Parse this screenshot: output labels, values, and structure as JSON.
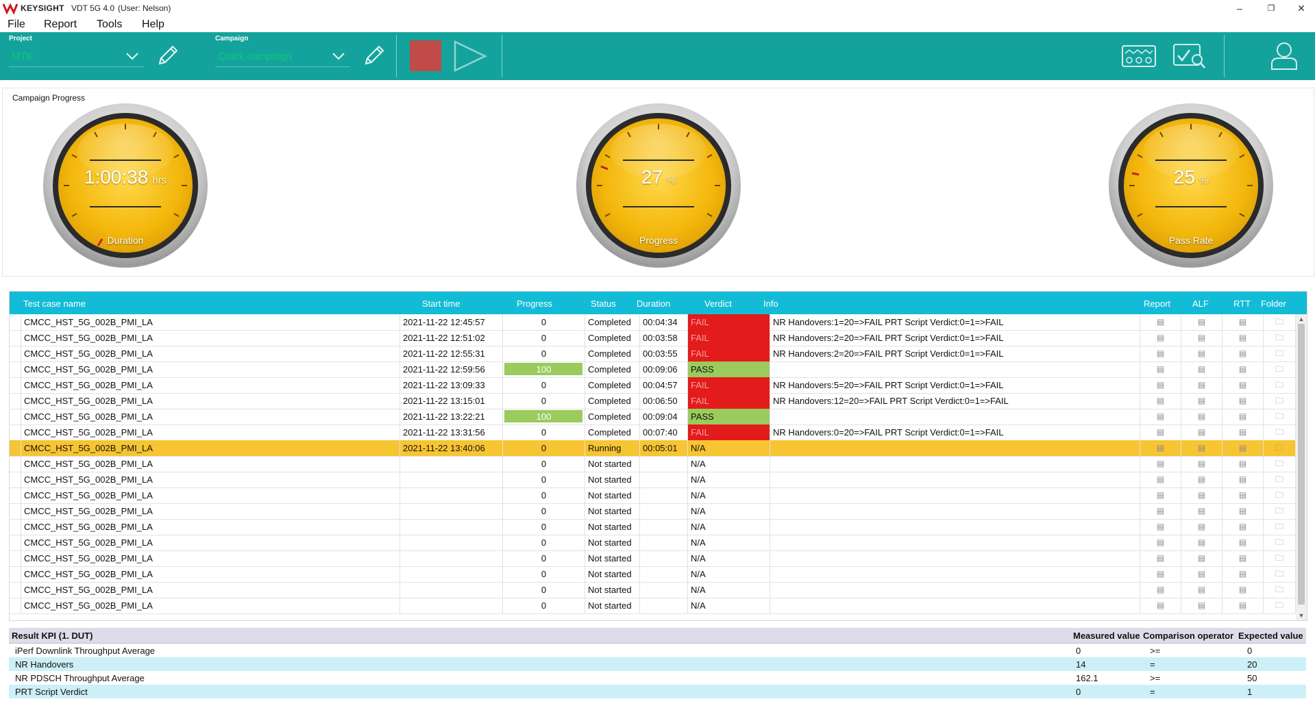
{
  "titlebar": {
    "brand": "KEYSIGHT",
    "app": "VDT 5G 4.0",
    "user": "(User: Nelson)",
    "minimize": "–",
    "restore": "❐",
    "close": "✕"
  },
  "menu": [
    "File",
    "Report",
    "Tools",
    "Help"
  ],
  "toolbar": {
    "project_label": "Project",
    "project_value": "MTK",
    "campaign_label": "Campaign",
    "campaign_value": "Quick campaign",
    "colors": {
      "bar": "#14a39c",
      "stop": "#c04b48",
      "select_text": "#0ec77c"
    }
  },
  "progress_panel": {
    "title": "Campaign Progress",
    "gauges": [
      {
        "label": "Duration",
        "value": "1:00:38",
        "unit": "hrs"
      },
      {
        "label": "Progress",
        "value": "27",
        "unit": "%"
      },
      {
        "label": "Pass Rate",
        "value": "25",
        "unit": "%"
      }
    ]
  },
  "table": {
    "headers": {
      "name": "Test case name",
      "start": "Start time",
      "progress": "Progress",
      "status": "Status",
      "duration": "Duration",
      "verdict": "Verdict",
      "info": "Info",
      "report": "Report",
      "alf": "ALF",
      "rtt": "RTT",
      "folder": "Folder"
    },
    "rows": [
      {
        "name": "CMCC_HST_5G_002B_PMI_LA",
        "start": "2021-11-22 12:45:57",
        "progress": "0",
        "status": "Completed",
        "duration": "00:04:34",
        "verdict": "FAIL",
        "info": "NR Handovers:1=20=>FAIL PRT Script Verdict:0=1=>FAIL"
      },
      {
        "name": "CMCC_HST_5G_002B_PMI_LA",
        "start": "2021-11-22 12:51:02",
        "progress": "0",
        "status": "Completed",
        "duration": "00:03:58",
        "verdict": "FAIL",
        "info": "NR Handovers:2=20=>FAIL PRT Script Verdict:0=1=>FAIL"
      },
      {
        "name": "CMCC_HST_5G_002B_PMI_LA",
        "start": "2021-11-22 12:55:31",
        "progress": "0",
        "status": "Completed",
        "duration": "00:03:55",
        "verdict": "FAIL",
        "info": "NR Handovers:2=20=>FAIL PRT Script Verdict:0=1=>FAIL"
      },
      {
        "name": "CMCC_HST_5G_002B_PMI_LA",
        "start": "2021-11-22 12:59:56",
        "progress": "100",
        "status": "Completed",
        "duration": "00:09:06",
        "verdict": "PASS",
        "info": ""
      },
      {
        "name": "CMCC_HST_5G_002B_PMI_LA",
        "start": "2021-11-22 13:09:33",
        "progress": "0",
        "status": "Completed",
        "duration": "00:04:57",
        "verdict": "FAIL",
        "info": "NR Handovers:5=20=>FAIL PRT Script Verdict:0=1=>FAIL"
      },
      {
        "name": "CMCC_HST_5G_002B_PMI_LA",
        "start": "2021-11-22 13:15:01",
        "progress": "0",
        "status": "Completed",
        "duration": "00:06:50",
        "verdict": "FAIL",
        "info": "NR Handovers:12=20=>FAIL PRT Script Verdict:0=1=>FAIL"
      },
      {
        "name": "CMCC_HST_5G_002B_PMI_LA",
        "start": "2021-11-22 13:22:21",
        "progress": "100",
        "status": "Completed",
        "duration": "00:09:04",
        "verdict": "PASS",
        "info": ""
      },
      {
        "name": "CMCC_HST_5G_002B_PMI_LA",
        "start": "2021-11-22 13:31:56",
        "progress": "0",
        "status": "Completed",
        "duration": "00:07:40",
        "verdict": "FAIL",
        "info": "NR Handovers:0=20=>FAIL PRT Script Verdict:0=1=>FAIL"
      },
      {
        "name": "CMCC_HST_5G_002B_PMI_LA",
        "start": "2021-11-22 13:40:06",
        "progress": "0",
        "status": "Running",
        "duration": "00:05:01",
        "verdict": "N/A",
        "info": ""
      },
      {
        "name": "CMCC_HST_5G_002B_PMI_LA",
        "start": "",
        "progress": "0",
        "status": "Not started",
        "duration": "",
        "verdict": "N/A",
        "info": ""
      },
      {
        "name": "CMCC_HST_5G_002B_PMI_LA",
        "start": "",
        "progress": "0",
        "status": "Not started",
        "duration": "",
        "verdict": "N/A",
        "info": ""
      },
      {
        "name": "CMCC_HST_5G_002B_PMI_LA",
        "start": "",
        "progress": "0",
        "status": "Not started",
        "duration": "",
        "verdict": "N/A",
        "info": ""
      },
      {
        "name": "CMCC_HST_5G_002B_PMI_LA",
        "start": "",
        "progress": "0",
        "status": "Not started",
        "duration": "",
        "verdict": "N/A",
        "info": ""
      },
      {
        "name": "CMCC_HST_5G_002B_PMI_LA",
        "start": "",
        "progress": "0",
        "status": "Not started",
        "duration": "",
        "verdict": "N/A",
        "info": ""
      },
      {
        "name": "CMCC_HST_5G_002B_PMI_LA",
        "start": "",
        "progress": "0",
        "status": "Not started",
        "duration": "",
        "verdict": "N/A",
        "info": ""
      },
      {
        "name": "CMCC_HST_5G_002B_PMI_LA",
        "start": "",
        "progress": "0",
        "status": "Not started",
        "duration": "",
        "verdict": "N/A",
        "info": ""
      },
      {
        "name": "CMCC_HST_5G_002B_PMI_LA",
        "start": "",
        "progress": "0",
        "status": "Not started",
        "duration": "",
        "verdict": "N/A",
        "info": ""
      },
      {
        "name": "CMCC_HST_5G_002B_PMI_LA",
        "start": "",
        "progress": "0",
        "status": "Not started",
        "duration": "",
        "verdict": "N/A",
        "info": ""
      },
      {
        "name": "CMCC_HST_5G_002B_PMI_LA",
        "start": "",
        "progress": "0",
        "status": "Not started",
        "duration": "",
        "verdict": "N/A",
        "info": ""
      }
    ],
    "running_color": "#f7c432",
    "fail_color": "#e31b1b",
    "pass_color": "#9acb5c"
  },
  "kpi": {
    "title": "Result KPI (1. DUT)",
    "col_measured": "Measured value",
    "col_operator": "Comparison operator",
    "col_expected": "Expected value",
    "rows": [
      {
        "name": "iPerf Downlink Throughput Average",
        "measured": "0",
        "operator": ">=",
        "expected": "0"
      },
      {
        "name": "NR Handovers",
        "measured": "14",
        "operator": "=",
        "expected": "20"
      },
      {
        "name": "NR PDSCH Throughput Average",
        "measured": "162.1",
        "operator": ">=",
        "expected": "50"
      },
      {
        "name": "PRT Script Verdict",
        "measured": "0",
        "operator": "=",
        "expected": "1"
      }
    ]
  }
}
